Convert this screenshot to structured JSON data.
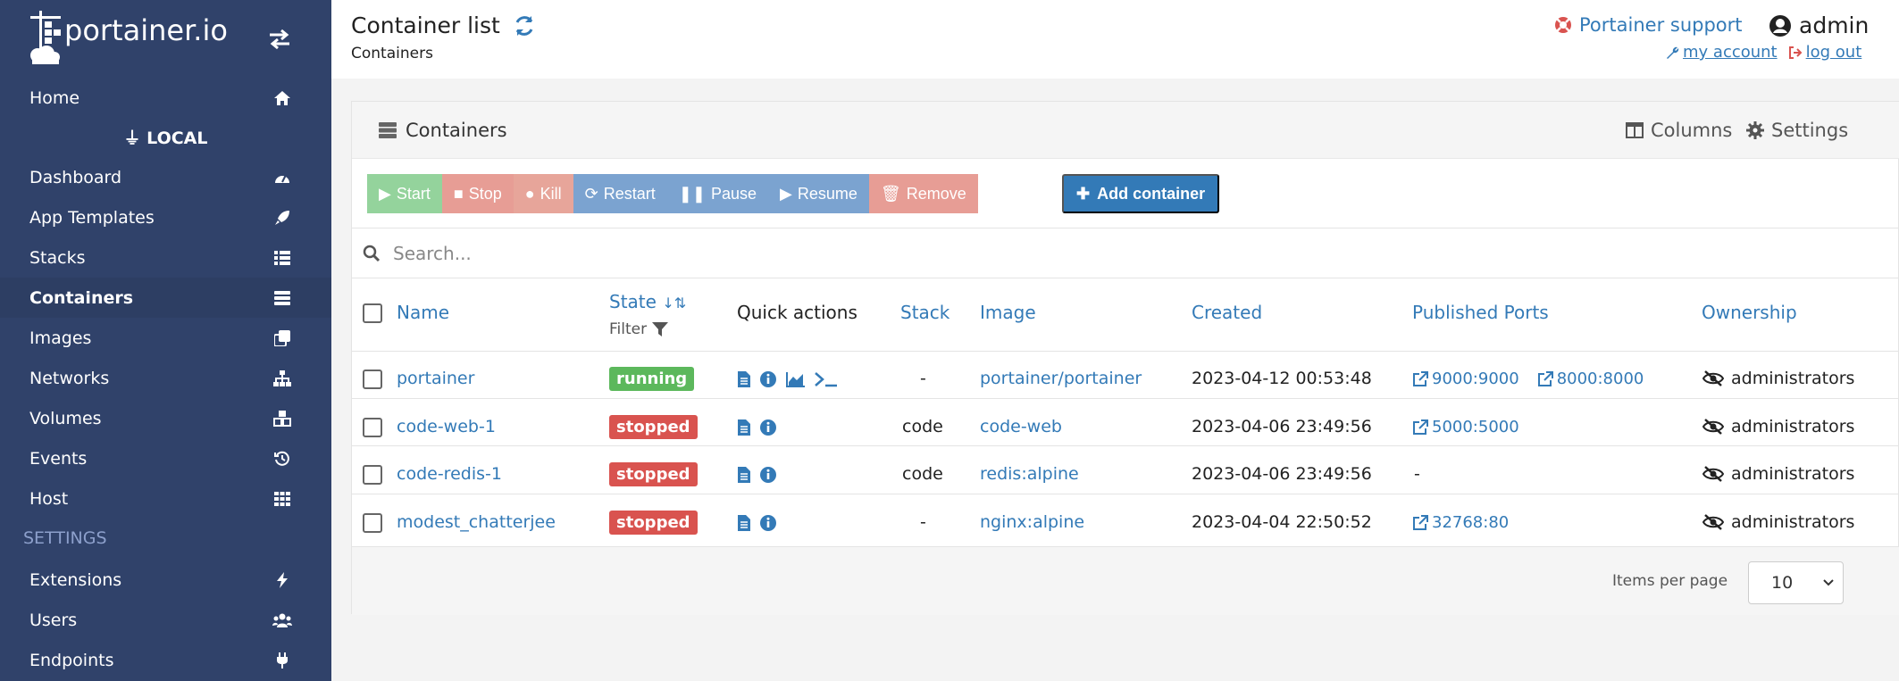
{
  "brand": {
    "name": "portainer.io"
  },
  "sidebar": {
    "endpoint": "LOCAL",
    "settings_label": "SETTINGS",
    "items": [
      {
        "label": "Home",
        "icon": "home-icon"
      },
      {
        "label": "Dashboard",
        "icon": "tachometer-icon"
      },
      {
        "label": "App Templates",
        "icon": "rocket-icon"
      },
      {
        "label": "Stacks",
        "icon": "th-list-icon"
      },
      {
        "label": "Containers",
        "icon": "server-icon"
      },
      {
        "label": "Images",
        "icon": "clone-icon"
      },
      {
        "label": "Networks",
        "icon": "sitemap-icon"
      },
      {
        "label": "Volumes",
        "icon": "cubes-icon"
      },
      {
        "label": "Events",
        "icon": "history-icon"
      },
      {
        "label": "Host",
        "icon": "th-icon"
      },
      {
        "label": "Extensions",
        "icon": "bolt-icon"
      },
      {
        "label": "Users",
        "icon": "users-icon"
      },
      {
        "label": "Endpoints",
        "icon": "plug-icon"
      }
    ]
  },
  "header": {
    "title": "Container list",
    "subtitle": "Containers",
    "support": "Portainer support",
    "user": "admin",
    "my_account": "my account",
    "log_out": "log out"
  },
  "panel": {
    "title": "Containers",
    "columns_label": "Columns",
    "settings_label": "Settings",
    "actions": {
      "start": "Start",
      "stop": "Stop",
      "kill": "Kill",
      "restart": "Restart",
      "pause": "Pause",
      "resume": "Resume",
      "remove": "Remove",
      "add": "Add container"
    },
    "search_placeholder": "Search...",
    "headers": {
      "name": "Name",
      "state": "State",
      "filter": "Filter",
      "quick_actions": "Quick actions",
      "stack": "Stack",
      "image": "Image",
      "created": "Created",
      "ports": "Published Ports",
      "ownership": "Ownership"
    },
    "rows": [
      {
        "name": "portainer",
        "state": "running",
        "stack": "-",
        "image": "portainer/portainer",
        "created": "2023-04-12 00:53:48",
        "ports": [
          "9000:9000",
          "8000:8000"
        ],
        "ports_text": "",
        "ownership": "administrators"
      },
      {
        "name": "code-web-1",
        "state": "stopped",
        "stack": "code",
        "image": "code-web",
        "created": "2023-04-06 23:49:56",
        "ports": [
          "5000:5000"
        ],
        "ports_text": "",
        "ownership": "administrators"
      },
      {
        "name": "code-redis-1",
        "state": "stopped",
        "stack": "code",
        "image": "redis:alpine",
        "created": "2023-04-06 23:49:56",
        "ports": [],
        "ports_text": "-",
        "ownership": "administrators"
      },
      {
        "name": "modest_chatterjee",
        "state": "stopped",
        "stack": "-",
        "image": "nginx:alpine",
        "created": "2023-04-04 22:50:52",
        "ports": [
          "32768:80"
        ],
        "ports_text": "",
        "ownership": "administrators"
      }
    ],
    "items_per_page_label": "Items per page",
    "items_per_page": "10"
  },
  "colors": {
    "sidebar": "#30426a",
    "link": "#337ab7",
    "running": "#5cb85c",
    "stopped": "#d9534f"
  }
}
